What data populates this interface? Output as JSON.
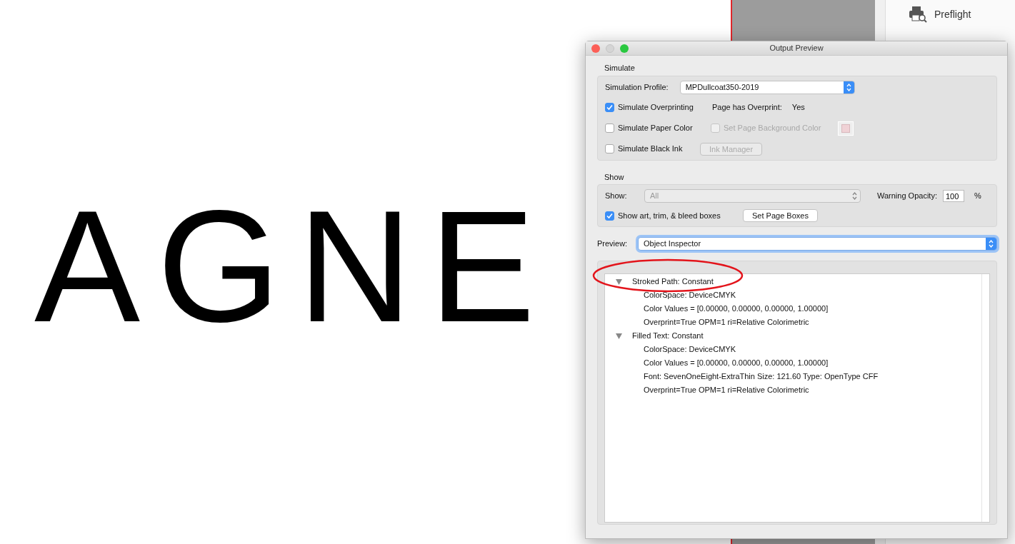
{
  "document": {
    "text": "AGNE"
  },
  "side_panel": {
    "items": [
      {
        "label": "Preflight"
      }
    ]
  },
  "window": {
    "title": "Output Preview"
  },
  "simulate": {
    "heading": "Simulate",
    "profile_label": "Simulation Profile:",
    "profile_value": "MPDullcoat350-2019",
    "overprinting": {
      "label": "Simulate Overprinting",
      "checked": true
    },
    "overprint_label": "Page has Overprint:",
    "overprint_value": "Yes",
    "paper_color": {
      "label": "Simulate Paper Color",
      "checked": false
    },
    "background_color": {
      "label": "Set Page Background Color",
      "checked": false,
      "disabled": true
    },
    "black_ink": {
      "label": "Simulate Black Ink",
      "checked": false
    },
    "ink_manager": {
      "label": "Ink Manager",
      "disabled": true
    }
  },
  "show": {
    "heading": "Show",
    "show_label": "Show:",
    "show_value": "All",
    "show_disabled": true,
    "opacity_label": "Warning Opacity:",
    "opacity_value": "100",
    "opacity_unit": "%",
    "boxes": {
      "label": "Show art, trim, & bleed boxes",
      "checked": true
    },
    "page_boxes_button": "Set Page Boxes"
  },
  "preview": {
    "label": "Preview:",
    "value": "Object Inspector"
  },
  "inspector": {
    "tree": [
      {
        "label": "Stroked Path: Constant",
        "expanded": true,
        "children": [
          {
            "label": "ColorSpace: DeviceCMYK"
          },
          {
            "label": "Color Values = [0.00000, 0.00000, 0.00000, 1.00000]"
          },
          {
            "label": "Overprint=True OPM=1 ri=Relative Colorimetric"
          }
        ]
      },
      {
        "label": "Filled Text: Constant",
        "expanded": true,
        "children": [
          {
            "label": "ColorSpace: DeviceCMYK"
          },
          {
            "label": "Color Values = [0.00000, 0.00000, 0.00000, 1.00000]"
          },
          {
            "label": "Font: SevenOneEight-ExtraThin Size: 121.60 Type: OpenType CFF"
          },
          {
            "label": "Overprint=True OPM=1 ri=Relative Colorimetric"
          }
        ]
      }
    ]
  }
}
